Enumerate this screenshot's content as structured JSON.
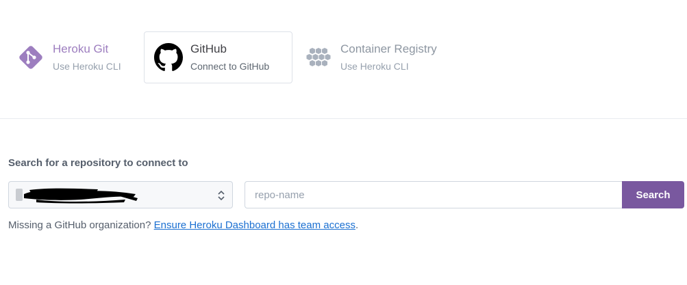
{
  "methods": [
    {
      "title": "Heroku Git",
      "subtitle": "Use Heroku CLI",
      "icon": "git-icon"
    },
    {
      "title": "GitHub",
      "subtitle": "Connect to GitHub",
      "icon": "github-icon"
    },
    {
      "title": "Container Registry",
      "subtitle": "Use Heroku CLI",
      "icon": "container-registry-icon"
    }
  ],
  "selected_method": "GitHub",
  "search": {
    "label": "Search for a repository to connect to",
    "repo_placeholder": "repo-name",
    "button_label": "Search"
  },
  "missing_org": {
    "text": "Missing a GitHub organization?",
    "link_text": "Ensure Heroku Dashboard has team access",
    "suffix": "."
  },
  "colors": {
    "accent": "#79589f",
    "heroku_purple": "#9d7ebf",
    "link": "#1a6fd1"
  }
}
